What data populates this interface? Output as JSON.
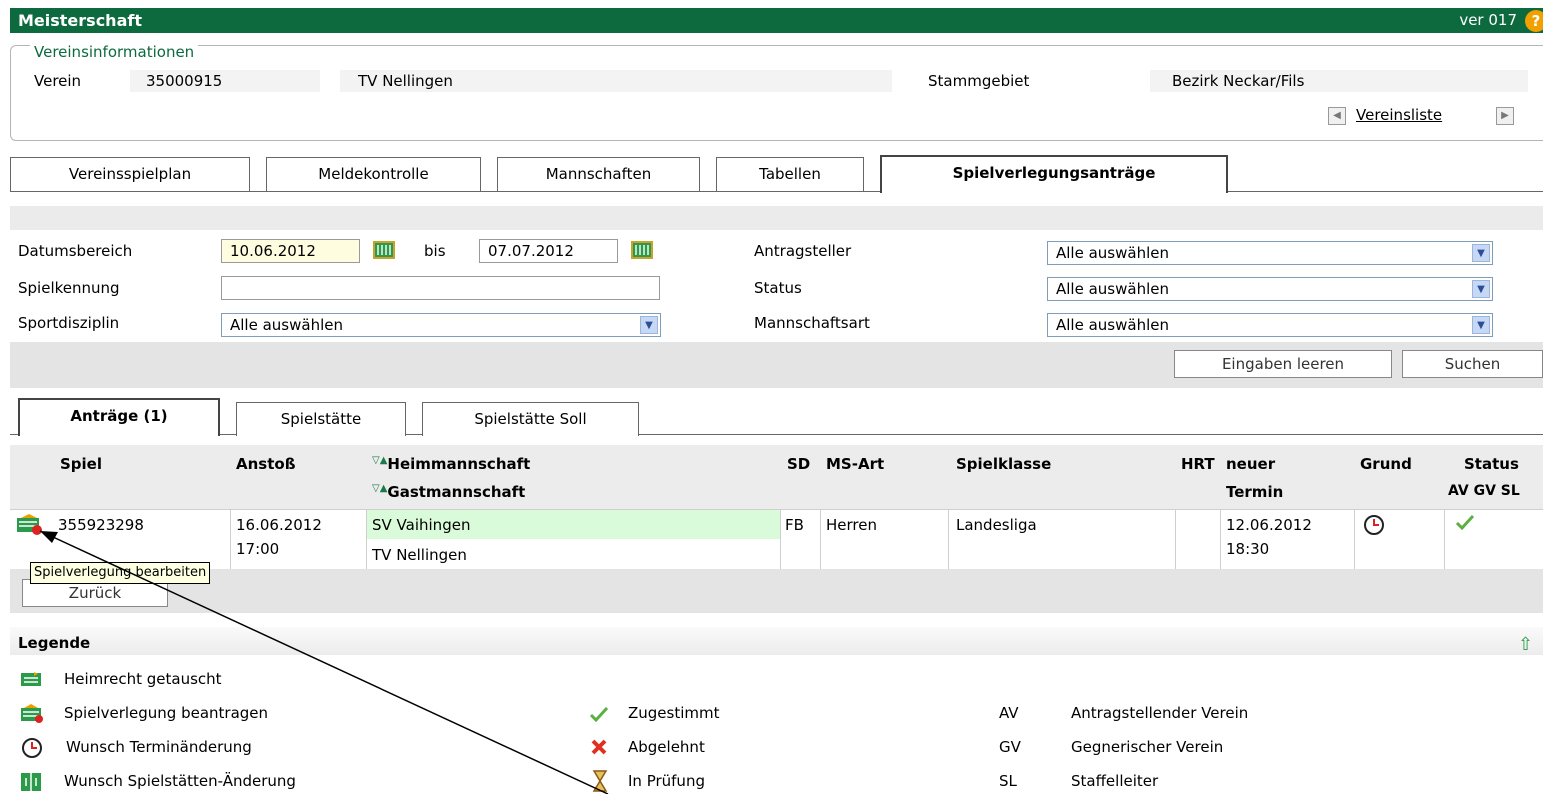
{
  "window": {
    "title": "Meisterschaft",
    "version": "ver 017",
    "help_glyph": "?"
  },
  "vereinsinfo": {
    "legend": "Vereinsinformationen",
    "verein_label": "Verein",
    "verein_nr": "35000915",
    "verein_name": "TV Nellingen",
    "stammgebiet_label": "Stammgebiet",
    "stammgebiet_value": "Bezirk Neckar/Fils",
    "vereinsliste_link": "Vereinsliste"
  },
  "main_tabs": [
    "Vereinsspielplan",
    "Meldekontrolle",
    "Mannschaften",
    "Tabellen",
    "Spielverlegungsanträge"
  ],
  "filter": {
    "datumsbereich_label": "Datumsbereich",
    "date_from": "10.06.2012",
    "bis_label": "bis",
    "date_to": "07.07.2012",
    "spielkennung_label": "Spielkennung",
    "spielkennung_value": "",
    "sportdisziplin_label": "Sportdisziplin",
    "sportdisziplin_value": "Alle auswählen",
    "antragsteller_label": "Antragsteller",
    "antragsteller_value": "Alle auswählen",
    "status_label": "Status",
    "status_value": "Alle auswählen",
    "mannschaftsart_label": "Mannschaftsart",
    "mannschaftsart_value": "Alle auswählen",
    "clear_button": "Eingaben leeren",
    "search_button": "Suchen"
  },
  "sub_tabs": [
    "Anträge (1)",
    "Spielstätte",
    "Spielstätte Soll"
  ],
  "table": {
    "headers": {
      "spiel": "Spiel",
      "anstoss": "Anstoß",
      "heim": "Heimmannschaft",
      "gast": "Gastmannschaft",
      "sort_glyph": "▽▲",
      "sd": "SD",
      "msart": "MS-Art",
      "spielklasse": "Spielklasse",
      "hrt": "HRT",
      "neuer1": "neuer",
      "neuer2": "Termin",
      "grund": "Grund",
      "status": "Status",
      "status_sub": "AV GV SL"
    },
    "row": {
      "spiel": "355923298",
      "anstoss_date": "16.06.2012",
      "anstoss_time": "17:00",
      "heim": "SV Vaihingen",
      "gast": "TV Nellingen",
      "sd": "FB",
      "msart": "Herren",
      "spielklasse": "Landesliga",
      "hrt": "",
      "neu_date": "12.06.2012",
      "neu_time": "18:30"
    },
    "tooltip": "Spielverlegung bearbeiten",
    "back_button": "Zurück"
  },
  "legend": {
    "title": "Legende",
    "items_left": [
      "Heimrecht getauscht",
      "Spielverlegung beantragen",
      "Wunsch Terminänderung",
      "Wunsch Spielstätten-Änderung"
    ],
    "items_mid": [
      "Zugestimmt",
      "Abgelehnt",
      "In Prüfung"
    ],
    "abbr": [
      "AV",
      "GV",
      "SL"
    ],
    "abbr_text": [
      "Antragstellender Verein",
      "Gegnerischer Verein",
      "Staffelleiter"
    ]
  },
  "colors": {
    "brand_green": "#0d6a3e",
    "highlight_green": "#d9fbd9",
    "tooltip_bg": "#ffffe1"
  }
}
